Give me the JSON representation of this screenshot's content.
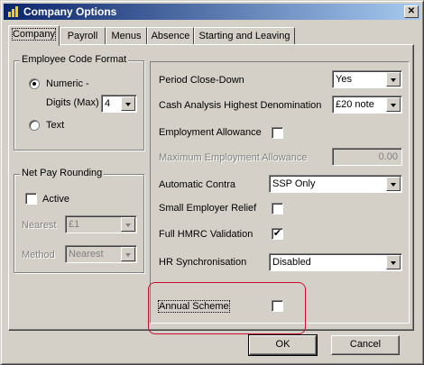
{
  "window": {
    "title": "Company Options"
  },
  "tabs": [
    {
      "label": "Company"
    },
    {
      "label": "Payroll"
    },
    {
      "label": "Menus"
    },
    {
      "label": "Absence"
    },
    {
      "label": "Starting and Leaving"
    }
  ],
  "employee_code": {
    "title": "Employee Code Format",
    "numeric_label_line1": "Numeric -",
    "numeric_label_line2": "Digits (Max)",
    "digits_value": "4",
    "text_label": "Text",
    "selected": "Numeric"
  },
  "net_pay": {
    "title": "Net Pay Rounding",
    "active_label": "Active",
    "active_checked": false,
    "nearest_label": "Nearest",
    "nearest_value": "£1",
    "method_label": "Method",
    "method_value": "Nearest"
  },
  "settings": {
    "period_close_label": "Period Close-Down",
    "period_close_value": "Yes",
    "cash_analysis_label": "Cash Analysis Highest Denomination",
    "cash_analysis_value": "£20 note",
    "employment_allowance_label": "Employment Allowance",
    "employment_allowance_checked": false,
    "max_allowance_label": "Maximum Employment Allowance",
    "max_allowance_value": "0.00",
    "automatic_contra_label": "Automatic Contra",
    "automatic_contra_value": "SSP Only",
    "small_employer_label": "Small Employer Relief",
    "small_employer_checked": false,
    "full_hmrc_label": "Full HMRC Validation",
    "full_hmrc_checked": true,
    "hr_sync_label": "HR Synchronisation",
    "hr_sync_value": "Disabled",
    "annual_scheme_label": "Annual Scheme",
    "annual_scheme_checked": false
  },
  "buttons": {
    "ok": "OK",
    "cancel": "Cancel"
  },
  "colors": {
    "highlight": "#c8102e",
    "title_bar": "#0a246a"
  },
  "icons": {
    "app": "bar-chart-icon",
    "close": "close-icon"
  }
}
